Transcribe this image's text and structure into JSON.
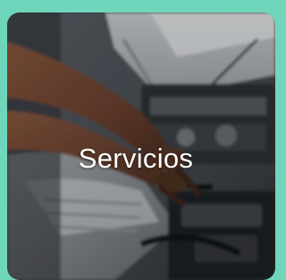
{
  "card": {
    "title": "Servicios",
    "accent_color": "#6fd6bb",
    "image_subject": "mechanic-hands-engine-bay"
  }
}
